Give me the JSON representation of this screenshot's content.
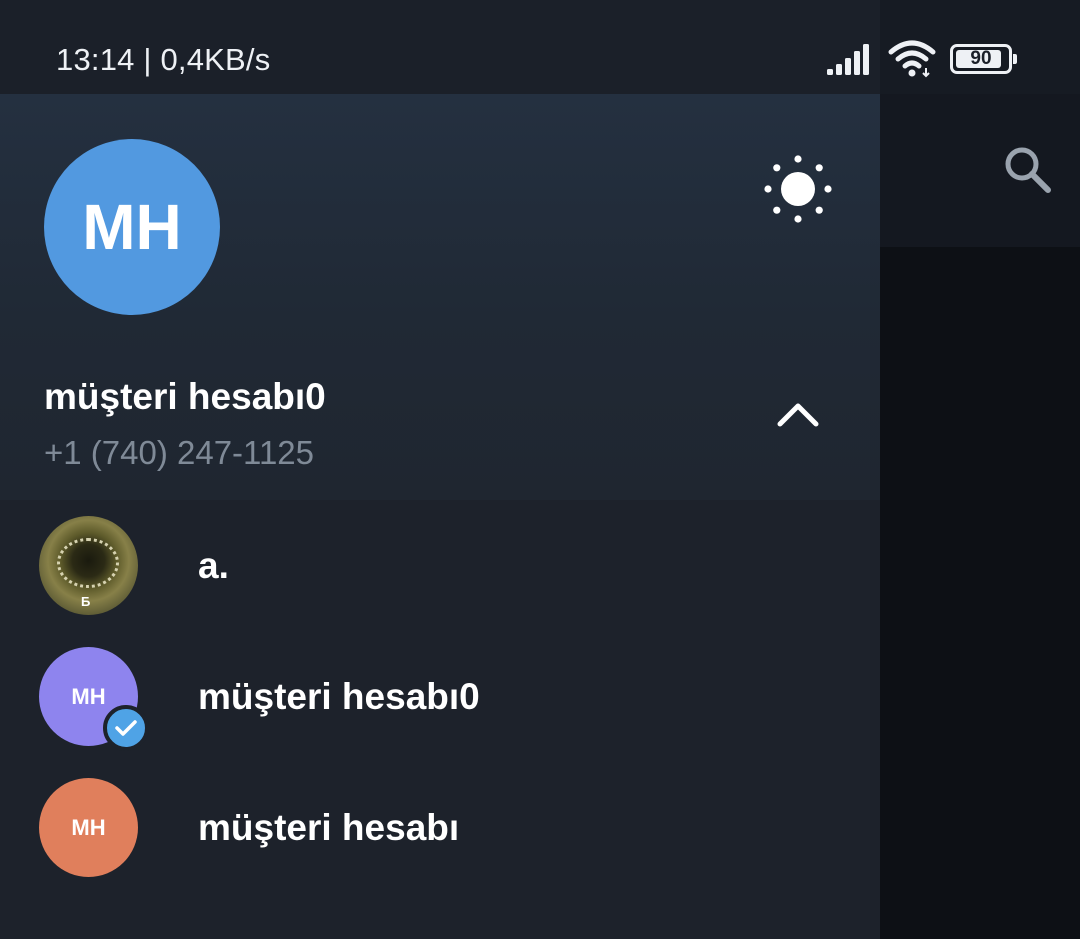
{
  "status_bar": {
    "time": "13:14 | 0,4KB/s",
    "battery_level": "90"
  },
  "main_screen": {
    "search_icon": "search-icon"
  },
  "drawer": {
    "profile": {
      "initials": "MH",
      "name": "müşteri hesabı0",
      "phone": "+1 (740) 247-1125",
      "avatar_color": "#5299e0"
    },
    "theme_icon": "sun-icon",
    "collapse_icon": "chevron-up-icon",
    "accounts": [
      {
        "label": "a.",
        "initials": "",
        "photo_mark": "Б",
        "avatar_color": "#5d5a2a",
        "selected": false
      },
      {
        "label": "müşteri hesabı0",
        "initials": "MH",
        "avatar_color": "#8e84ee",
        "selected": true
      },
      {
        "label": "müşteri hesabı",
        "initials": "MH",
        "avatar_color": "#e07f5c",
        "selected": false
      }
    ]
  },
  "colors": {
    "drawer_bg": "#1d222b",
    "header_bg": "#243040",
    "accent_blue": "#4fa3e6",
    "secondary_text": "#7f8a97"
  }
}
